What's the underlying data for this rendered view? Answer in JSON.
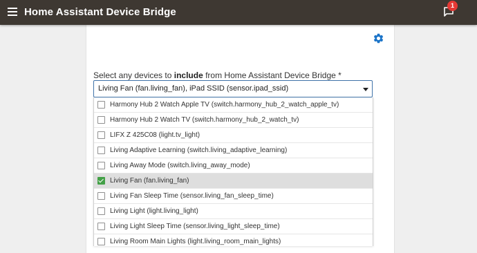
{
  "header": {
    "title": "Home Assistant Device Bridge",
    "notification_count": "1",
    "bar_color": "#3e3832"
  },
  "form": {
    "label_before": "Select any devices to ",
    "label_bold": "include",
    "label_after": " from Home Assistant Device Bridge *",
    "selected_value": "Living Fan (fan.living_fan), iPad SSID (sensor.ipad_ssid)",
    "accent_color": "#3f72a8"
  },
  "options": [
    {
      "label": "Harmony Hub 2 Watch Apple TV (switch.harmony_hub_2_watch_apple_tv)",
      "checked": false
    },
    {
      "label": "Harmony Hub 2 Watch TV (switch.harmony_hub_2_watch_tv)",
      "checked": false
    },
    {
      "label": "LIFX Z 425C08 (light.tv_light)",
      "checked": false
    },
    {
      "label": "Living Adaptive Learning (switch.living_adaptive_learning)",
      "checked": false
    },
    {
      "label": "Living Away Mode (switch.living_away_mode)",
      "checked": false
    },
    {
      "label": "Living Fan (fan.living_fan)",
      "checked": true
    },
    {
      "label": "Living Fan Sleep Time (sensor.living_fan_sleep_time)",
      "checked": false
    },
    {
      "label": "Living Light (light.living_light)",
      "checked": false
    },
    {
      "label": "Living Light Sleep Time (sensor.living_light_sleep_time)",
      "checked": false
    },
    {
      "label": "Living Room Main Lights (light.living_room_main_lights)",
      "checked": false
    }
  ],
  "icons": {
    "menu": "menu-icon",
    "notifications": "chat-bubble-icon",
    "settings": "gear-icon",
    "dropdown": "caret-down-icon",
    "check": "checkmark-icon"
  }
}
